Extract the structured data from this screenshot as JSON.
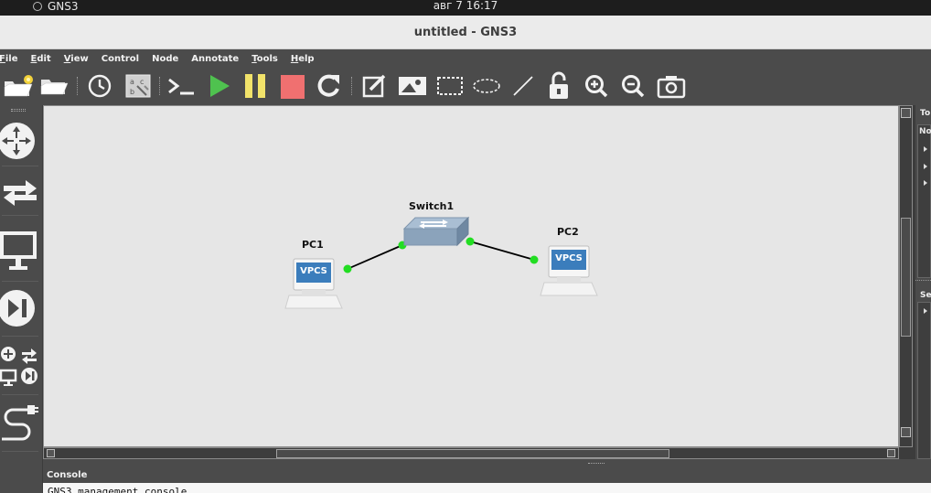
{
  "system_bar": {
    "app_name": "GNS3",
    "clock": "авг 7  16:17"
  },
  "window": {
    "title": "untitled - GNS3"
  },
  "menu": [
    {
      "label": "File",
      "accel": "F",
      "rest": "ile"
    },
    {
      "label": "Edit",
      "accel": "E",
      "rest": "dit"
    },
    {
      "label": "View",
      "accel": "V",
      "rest": "iew"
    },
    {
      "label": "Control",
      "accel": "",
      "rest": "Control"
    },
    {
      "label": "Node",
      "accel": "",
      "rest": "Node"
    },
    {
      "label": "Annotate",
      "accel": "",
      "rest": "Annotate"
    },
    {
      "label": "Tools",
      "accel": "T",
      "rest": "ools"
    },
    {
      "label": "Help",
      "accel": "H",
      "rest": "elp"
    }
  ],
  "toolbar": {
    "icons": [
      "new-project-icon",
      "open-project-icon",
      "snapshot-icon",
      "show-interface-labels-icon",
      "console-all-icon",
      "start-all-icon",
      "suspend-all-icon",
      "stop-all-icon",
      "reload-all-icon",
      "add-note-icon",
      "insert-picture-icon",
      "draw-rectangle-icon",
      "draw-ellipse-icon",
      "draw-line-icon",
      "lock-items-icon",
      "zoom-in-icon",
      "zoom-out-icon",
      "screenshot-icon"
    ],
    "colors": {
      "start": "#4fc24f",
      "suspend": "#f2e36a",
      "stop": "#f07070"
    }
  },
  "left_dock": {
    "items": [
      "browse-routers-icon",
      "browse-switches-icon",
      "browse-end-devices-icon",
      "browse-security-devices-icon",
      "browse-all-devices-icon",
      "add-link-icon"
    ]
  },
  "topology": {
    "nodes": [
      {
        "name": "PC1",
        "type": "VPCS",
        "badge": "VPCS"
      },
      {
        "name": "Switch1",
        "type": "ethernet-switch"
      },
      {
        "name": "PC2",
        "type": "VPCS",
        "badge": "VPCS"
      }
    ],
    "links": [
      {
        "from": "PC1",
        "to": "Switch1",
        "status": "up"
      },
      {
        "from": "Switch1",
        "to": "PC2",
        "status": "up"
      }
    ],
    "link_status_color": "#22dd22"
  },
  "right_dock": {
    "top_title": "To",
    "top_header": "No",
    "bottom_title": "Se"
  },
  "console": {
    "title": "Console",
    "text": "GNS3 management console."
  }
}
